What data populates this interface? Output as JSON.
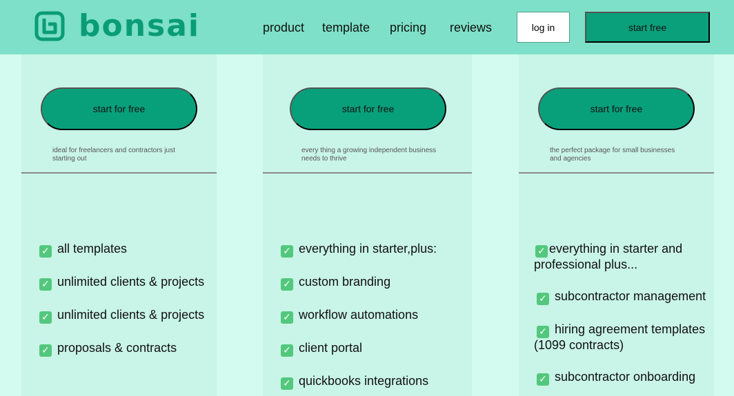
{
  "header": {
    "logo_text": "bonsai",
    "nav": [
      {
        "label": "product"
      },
      {
        "label": "template"
      },
      {
        "label": "pricing"
      },
      {
        "label": "reviews"
      }
    ],
    "login_label": "log in",
    "start_label": "start free"
  },
  "plans": [
    {
      "cta": "start for free",
      "description": "ideal for freelancers and contractors just starting out",
      "features": [
        "all templates",
        "unlimited clients & projects",
        "unlimited clients & projects",
        "proposals & contracts"
      ]
    },
    {
      "cta": "start for free",
      "description": "every thing a growing independent business needs to thrive",
      "features": [
        "everything in starter,plus:",
        "custom branding",
        "workflow automations",
        "client portal",
        "quickbooks integrations"
      ]
    },
    {
      "cta": "start for free",
      "description": "the perfect package for small businesses and agencies",
      "features": [
        "everything in starter and professional plus...",
        "subcontractor management",
        "hiring agreement templates (1099 contracts)",
        "subcontractor onboarding"
      ]
    }
  ],
  "check_icon": "check-box-icon",
  "colors": {
    "header_bg": "#7ee0c8",
    "page_bg": "#d3fbef",
    "card_bg": "#c9f4e8",
    "brand": "#0a9c77",
    "check": "#53c87d"
  }
}
